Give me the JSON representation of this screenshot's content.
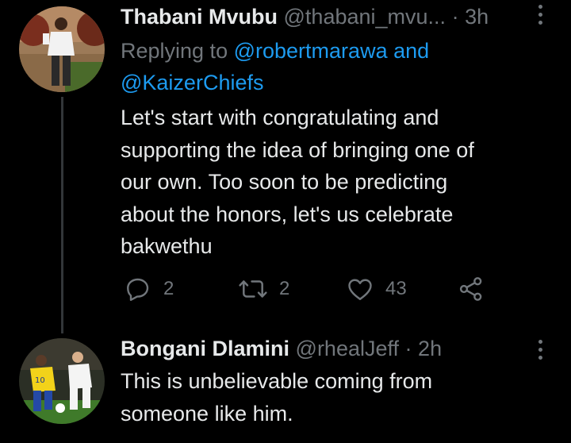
{
  "tweets": [
    {
      "author_name": "Thabani Mvubu",
      "handle": "@thabani_mvu...",
      "separator": "·",
      "time": "3h",
      "replying_prefix": "Replying to",
      "mention_1": "@robertmarawa",
      "mention_and": "and",
      "mention_2": "@KaizerChiefs",
      "text_lines": [
        "Let's start with congratulating and",
        "supporting the idea of bringing one of",
        "our own. Too soon to be predicting",
        "about the honors, let's us celebrate",
        "bakwethu"
      ],
      "replies": "2",
      "retweets": "2",
      "likes": "43",
      "icons": {
        "reply": "reply-icon",
        "retweet": "retweet-icon",
        "like": "heart-icon",
        "share": "share-icon",
        "more": "more-vertical-icon"
      }
    },
    {
      "author_name": "Bongani Dlamini",
      "handle": "@rhealJeff",
      "separator": "·",
      "time": "2h",
      "text_lines": [
        "This is unbelievable coming from",
        "someone like him."
      ]
    }
  ],
  "colors": {
    "background": "#000000",
    "text": "#e7e9ea",
    "muted": "#71767b",
    "link": "#1d9bf0"
  }
}
